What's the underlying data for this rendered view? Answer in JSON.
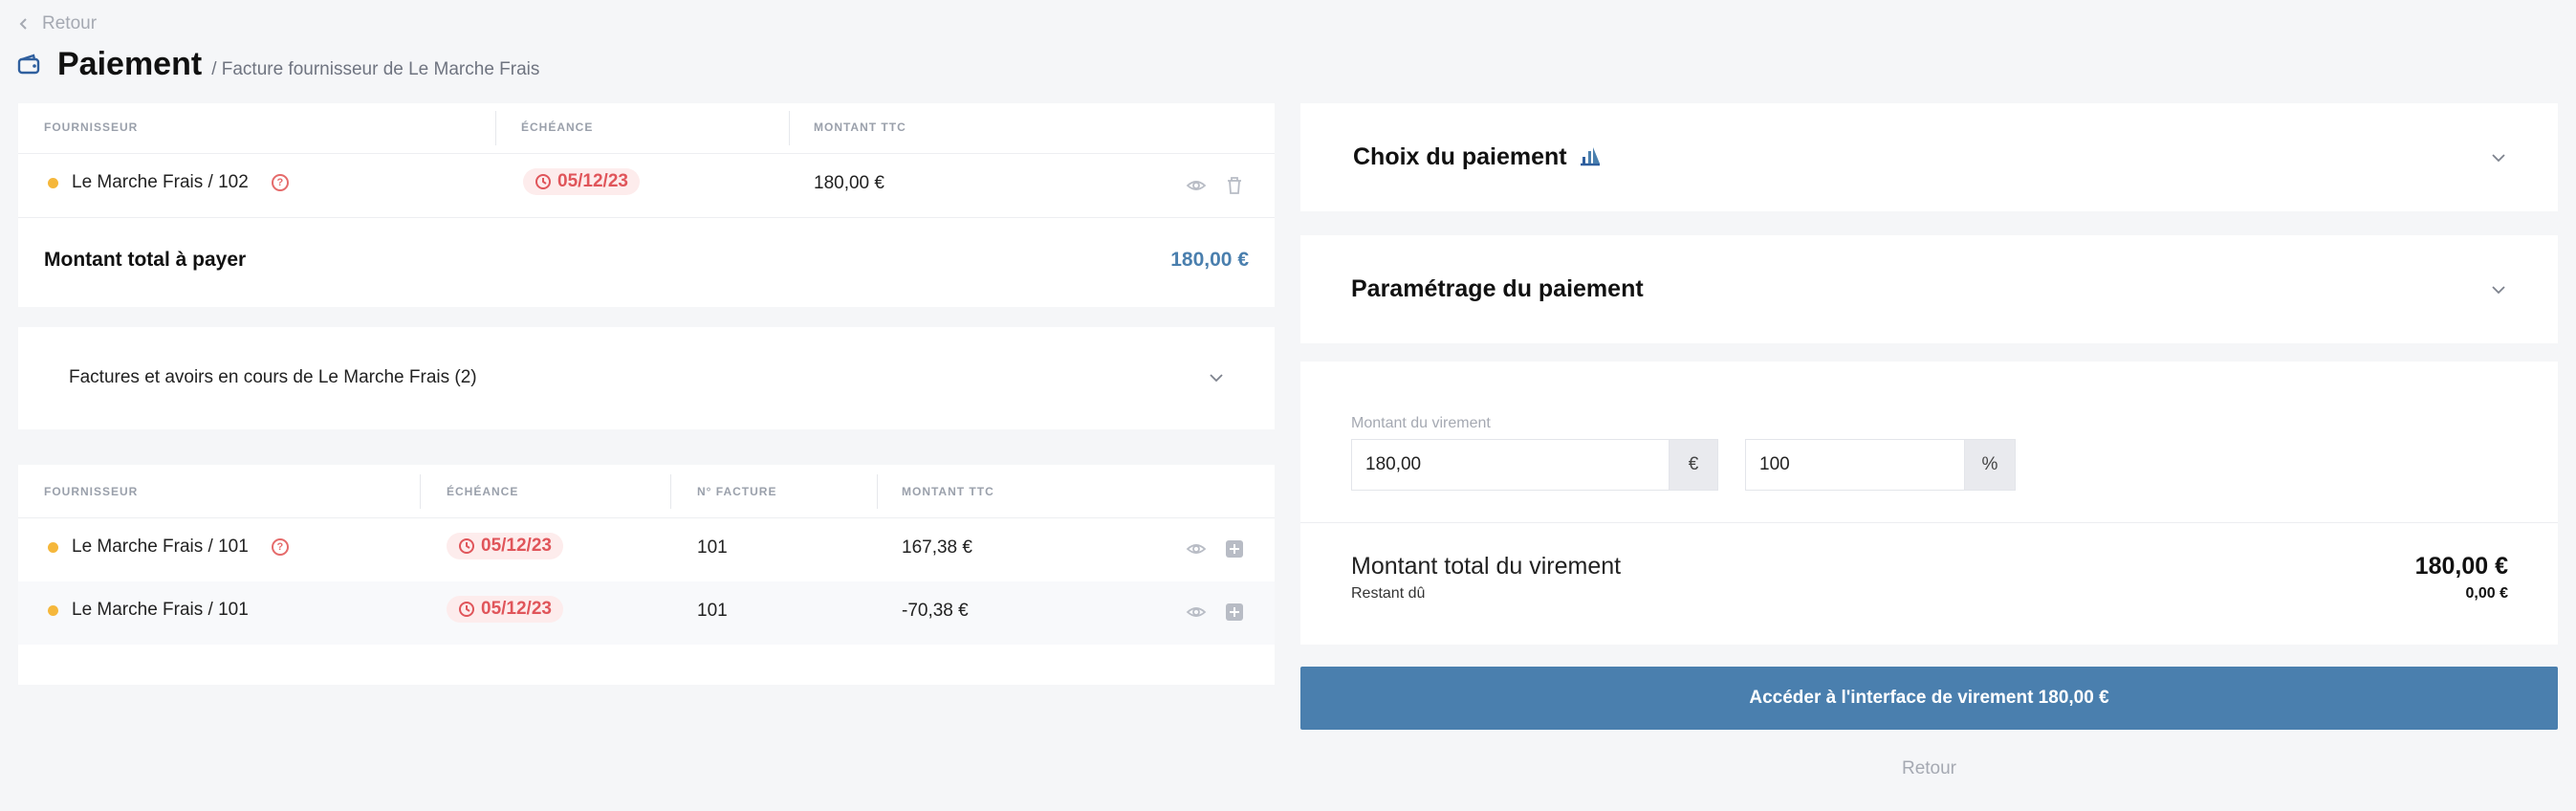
{
  "nav": {
    "back_label": "Retour"
  },
  "header": {
    "title": "Paiement",
    "breadcrumb": "/ Facture fournisseur de Le Marche Frais"
  },
  "selected_table": {
    "headers": [
      "FOURNISSEUR",
      "ÉCHÉANCE",
      "MONTANT TTC"
    ],
    "rows": [
      {
        "supplier": "Le Marche Frais / 102",
        "due": "05/12/23",
        "amount": "180,00 €"
      }
    ],
    "total_label": "Montant total à payer",
    "total_value": "180,00 €"
  },
  "pending": {
    "accordion_title": "Factures et avoirs en cours de Le Marche Frais (2)",
    "headers": [
      "FOURNISSEUR",
      "ÉCHÉANCE",
      "N° FACTURE",
      "MONTANT TTC"
    ],
    "rows": [
      {
        "supplier": "Le Marche Frais / 101",
        "due": "05/12/23",
        "invoice": "101",
        "amount": "167,38 €"
      },
      {
        "supplier": "Le Marche Frais / 101",
        "due": "05/12/23",
        "invoice": "101",
        "amount": "-70,38 €"
      }
    ]
  },
  "payment_choice": {
    "title": "Choix du paiement"
  },
  "payment_settings": {
    "title": "Paramétrage du paiement"
  },
  "transfer": {
    "label": "Montant du virement",
    "amount_value": "180,00",
    "amount_unit": "€",
    "percent_value": "100",
    "percent_unit": "%"
  },
  "summary": {
    "total_label": "Montant total du virement",
    "total_value": "180,00 €",
    "remaining_label": "Restant dû",
    "remaining_value": "0,00 €"
  },
  "actions": {
    "cta_label": "Accéder à l'interface de virement 180,00 €",
    "back_label": "Retour"
  },
  "colors": {
    "accent": "#4a7fae",
    "danger": "#e0555a",
    "warning_dot": "#f5b73b"
  },
  "icons": [
    "chevron-left-icon",
    "wallet-icon",
    "question-icon",
    "clock-icon",
    "eye-icon",
    "trash-icon",
    "plus-square-icon",
    "chevron-down-icon",
    "bank-icon"
  ]
}
